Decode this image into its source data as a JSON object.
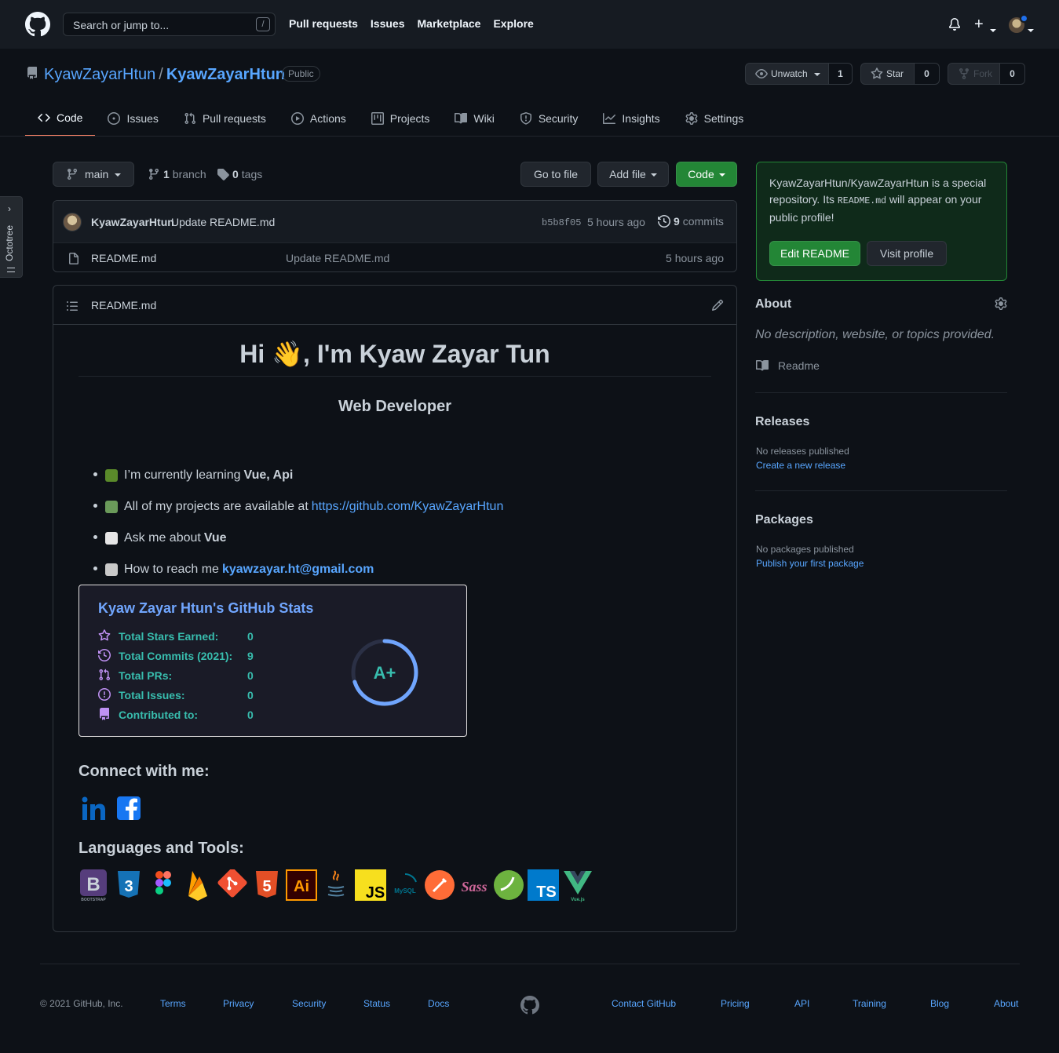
{
  "header": {
    "search_placeholder": "Search or jump to...",
    "slash_key": "/",
    "nav": [
      "Pull requests",
      "Issues",
      "Marketplace",
      "Explore"
    ]
  },
  "repo": {
    "owner": "KyawZayarHtun",
    "separator": "/",
    "name": "KyawZayarHtun",
    "visibility": "Public",
    "watch_label": "Unwatch",
    "watch_count": "1",
    "star_label": "Star",
    "star_count": "0",
    "fork_label": "Fork",
    "fork_count": "0"
  },
  "tabs": [
    {
      "label": "Code",
      "icon": "code-icon"
    },
    {
      "label": "Issues",
      "icon": "issue-icon"
    },
    {
      "label": "Pull requests",
      "icon": "pull-request-icon"
    },
    {
      "label": "Actions",
      "icon": "play-icon"
    },
    {
      "label": "Projects",
      "icon": "project-icon"
    },
    {
      "label": "Wiki",
      "icon": "book-icon"
    },
    {
      "label": "Security",
      "icon": "shield-icon"
    },
    {
      "label": "Insights",
      "icon": "graph-icon"
    },
    {
      "label": "Settings",
      "icon": "gear-icon"
    }
  ],
  "octotree": {
    "label": "Octotree"
  },
  "file_nav": {
    "branch": "main",
    "branch_count": "1",
    "branch_word": "branch",
    "tag_count": "0",
    "tag_word": "tags",
    "go_to_file": "Go to file",
    "add_file": "Add file",
    "code": "Code"
  },
  "commit": {
    "author": "KyawZayarHtun",
    "message": "Update README.md",
    "sha": "b5b8f05",
    "time": "5 hours ago",
    "count": "9",
    "count_word": "commits"
  },
  "files": [
    {
      "name": "README.md",
      "commit": "Update README.md",
      "time": "5 hours ago"
    }
  ],
  "readme": {
    "file_title": "README.md",
    "h1": "Hi 👋, I'm Kyaw Zayar Tun",
    "subtitle": "Web Developer",
    "bullets": [
      {
        "text": "I’m currently learning",
        "strong": "Vue, Api"
      },
      {
        "text": "All of my projects are available at",
        "link": "https://github.com/KyawZayarHtun"
      },
      {
        "text": "Ask me about",
        "strong": "Vue"
      },
      {
        "text": "How to reach me",
        "link": "kyawzayar.ht@gmail.com"
      }
    ],
    "stats": {
      "title": "Kyaw Zayar Htun's GitHub Stats",
      "rows": [
        {
          "label": "Total Stars Earned:",
          "value": "0",
          "icon": "star-icon"
        },
        {
          "label": "Total Commits (2021):",
          "value": "9",
          "icon": "history-icon"
        },
        {
          "label": "Total PRs:",
          "value": "0",
          "icon": "pull-request-icon"
        },
        {
          "label": "Total Issues:",
          "value": "0",
          "icon": "issue-icon"
        },
        {
          "label": "Contributed to:",
          "value": "0",
          "icon": "repo-icon"
        }
      ],
      "rank": "A+",
      "rank_progress": 0.7
    },
    "connect_heading": "Connect with me:",
    "langs_heading": "Languages and Tools:",
    "tools": [
      {
        "name": "bootstrap",
        "label": "B",
        "sub": "BOOTSTRAP"
      },
      {
        "name": "css3",
        "label": "3"
      },
      {
        "name": "figma",
        "label": ""
      },
      {
        "name": "firebase",
        "label": ""
      },
      {
        "name": "git",
        "label": ""
      },
      {
        "name": "html5",
        "label": "5"
      },
      {
        "name": "illustrator",
        "label": "Ai"
      },
      {
        "name": "java",
        "label": ""
      },
      {
        "name": "javascript",
        "label": "JS"
      },
      {
        "name": "mysql",
        "label": "MySQL"
      },
      {
        "name": "postman",
        "label": ""
      },
      {
        "name": "sass",
        "label": "Sass"
      },
      {
        "name": "spring",
        "label": ""
      },
      {
        "name": "typescript",
        "label": "TS"
      },
      {
        "name": "vuejs",
        "label": "Vue.js"
      }
    ]
  },
  "sidebar": {
    "special_repo": "KyawZayarHtun/KyawZayarHtun",
    "special_text_1": "is a special repository. Its",
    "special_code": "README.md",
    "special_text_2": "will appear on your public profile!",
    "edit_readme": "Edit README",
    "visit_profile": "Visit profile",
    "about_title": "About",
    "about_desc": "No description, website, or topics provided.",
    "readme_label": "Readme",
    "releases_title": "Releases",
    "releases_none": "No releases published",
    "releases_link": "Create a new release",
    "packages_title": "Packages",
    "packages_none": "No packages published",
    "packages_link": "Publish your first package"
  },
  "footer": {
    "copyright": "© 2021 GitHub, Inc.",
    "left_links": [
      "Terms",
      "Privacy",
      "Security",
      "Status",
      "Docs"
    ],
    "right_links": [
      "Contact GitHub",
      "Pricing",
      "API",
      "Training",
      "Blog",
      "About"
    ]
  },
  "colors": {
    "bg": "#0d1117",
    "header_bg": "#161b22",
    "link": "#58a6ff",
    "green": "#238636",
    "active_tab": "#f78166",
    "stats_title": "#70a5fd",
    "stats_text": "#38bdae"
  }
}
